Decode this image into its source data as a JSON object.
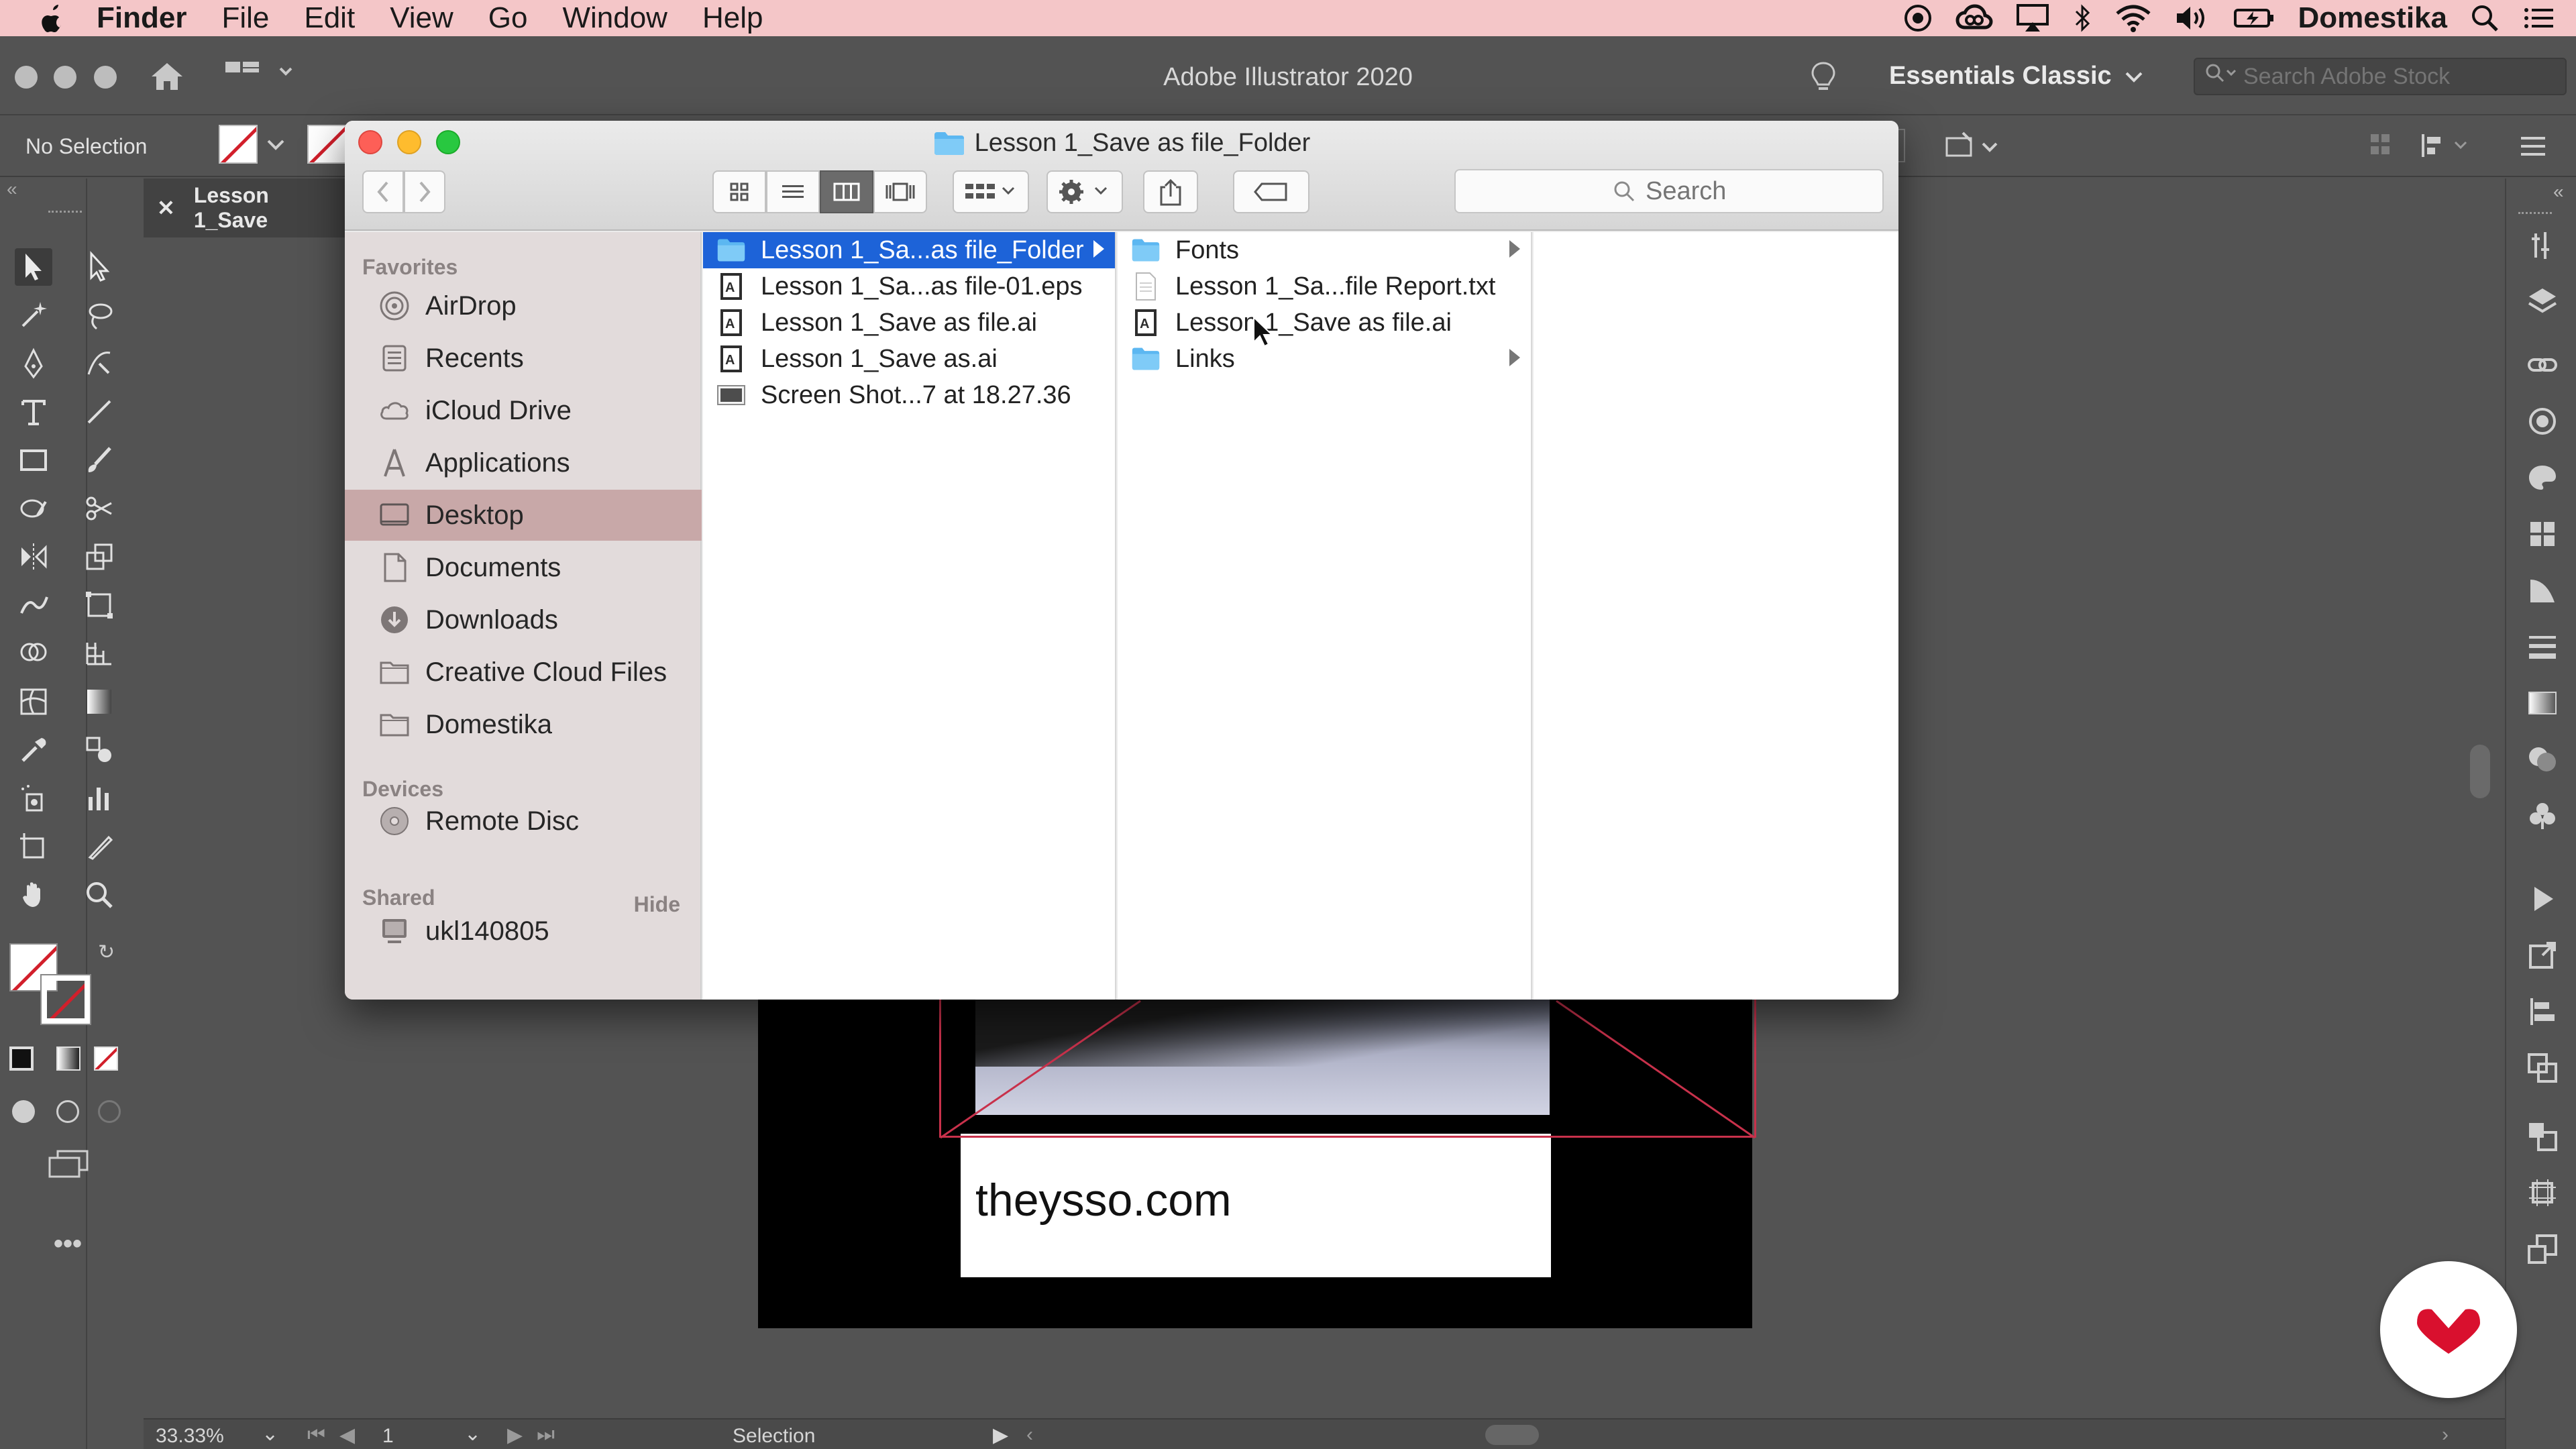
{
  "menubar": {
    "app_name": "Finder",
    "items": [
      "File",
      "Edit",
      "View",
      "Go",
      "Window",
      "Help"
    ],
    "user": "Domestika"
  },
  "illustrator": {
    "title": "Adobe Illustrator 2020",
    "workspace": "Essentials Classic",
    "stock_search_placeholder": "Search Adobe Stock",
    "no_selection": "No Selection",
    "doc_tab": "Lesson 1_Save",
    "zoom": "33.33%",
    "artboard_number": "1",
    "status_tool": "Selection",
    "artwork_text": "theysso.com"
  },
  "finder": {
    "window_title": "Lesson 1_Save as file_Folder",
    "search_placeholder": "Search",
    "sidebar": {
      "favorites_heading": "Favorites",
      "favorites": [
        {
          "label": "AirDrop",
          "icon": "airdrop-icon"
        },
        {
          "label": "Recents",
          "icon": "recents-icon"
        },
        {
          "label": "iCloud Drive",
          "icon": "cloud-icon"
        },
        {
          "label": "Applications",
          "icon": "applications-icon"
        },
        {
          "label": "Desktop",
          "icon": "desktop-icon",
          "selected": true
        },
        {
          "label": "Documents",
          "icon": "document-icon"
        },
        {
          "label": "Downloads",
          "icon": "download-icon"
        },
        {
          "label": "Creative Cloud Files",
          "icon": "folder-icon"
        },
        {
          "label": "Domestika",
          "icon": "folder-icon"
        }
      ],
      "devices_heading": "Devices",
      "devices": [
        {
          "label": "Remote Disc",
          "icon": "disc-icon"
        }
      ],
      "shared_heading": "Shared",
      "hide_label": "Hide",
      "shared": [
        {
          "label": "ukl140805",
          "icon": "computer-icon"
        }
      ]
    },
    "column1": [
      {
        "label": "Lesson 1_Sa...as file_Folder",
        "type": "folder",
        "selected": true,
        "has_children": true
      },
      {
        "label": "Lesson 1_Sa...as file-01.eps",
        "type": "ai-file"
      },
      {
        "label": "Lesson 1_Save as file.ai",
        "type": "ai-file"
      },
      {
        "label": "Lesson 1_Save as.ai",
        "type": "ai-file"
      },
      {
        "label": "Screen Shot...7 at 18.27.36",
        "type": "image-file"
      }
    ],
    "column2": [
      {
        "label": "Fonts",
        "type": "folder",
        "has_children": true
      },
      {
        "label": "Lesson 1_Sa...file Report.txt",
        "type": "text-file"
      },
      {
        "label": "Lesson 1_Save as file.ai",
        "type": "ai-file"
      },
      {
        "label": "Links",
        "type": "folder",
        "has_children": true
      }
    ]
  },
  "colors": {
    "menubar_bg": "#f4c6c8",
    "selection_blue": "#1d63d8",
    "sidebar_selected": "#c8a8a8",
    "app_bg": "#535353",
    "badge_red": "#d9102e"
  }
}
